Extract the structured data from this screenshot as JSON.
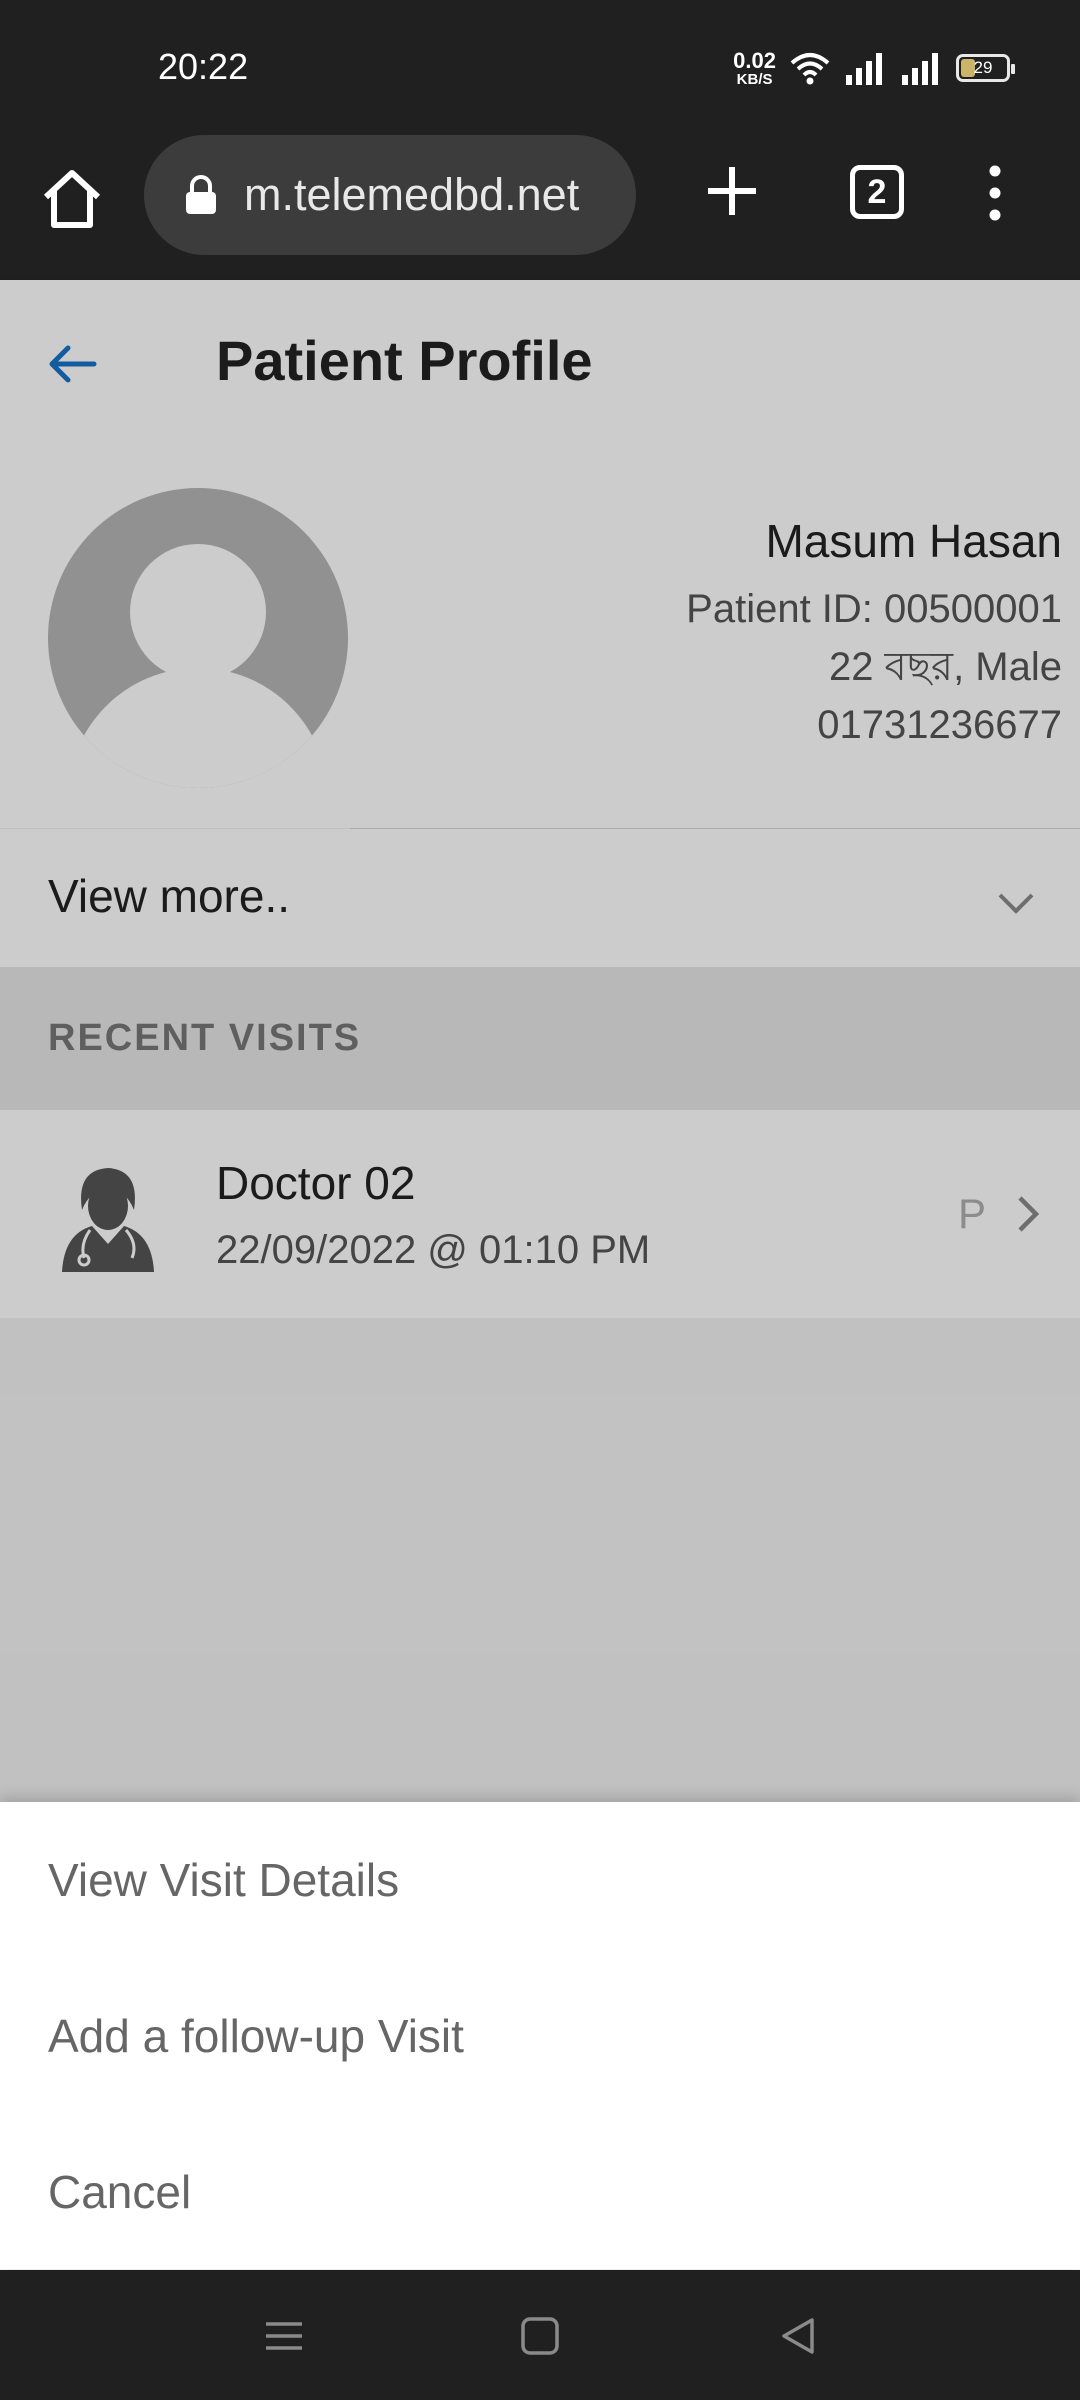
{
  "status_bar": {
    "time": "20:22",
    "net_speed_value": "0.02",
    "net_speed_unit": "KB/S",
    "battery_level": "29"
  },
  "browser": {
    "url": "m.telemedbd.net",
    "tab_count": "2"
  },
  "header": {
    "title": "Patient Profile"
  },
  "patient": {
    "name": "Masum Hasan",
    "patient_id": "Patient ID: 00500001",
    "age_gender": "22 বছর, Male",
    "phone": "01731236677"
  },
  "view_more_label": "View more..",
  "recent_visits": {
    "heading": "RECENT VISITS",
    "items": [
      {
        "doctor": "Doctor 02",
        "datetime": "22/09/2022 @ 01:10 PM",
        "badge": "P"
      }
    ]
  },
  "action_sheet": {
    "items": [
      {
        "label": "View Visit Details"
      },
      {
        "label": "Add a follow-up Visit"
      },
      {
        "label": "Cancel"
      }
    ]
  },
  "colors": {
    "accent": "#1a73c8",
    "status_bar_bg": "#202020",
    "page_bg": "#f2f2f2"
  }
}
